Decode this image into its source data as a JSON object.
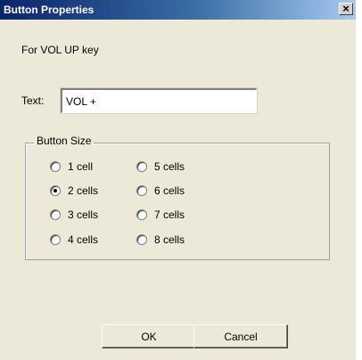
{
  "dialog": {
    "title": "Button Properties",
    "close_glyph": "×",
    "for_label": "For VOL UP key",
    "text_label": "Text:",
    "text_value": "VOL +",
    "group_label": "Button Size",
    "options": [
      {
        "label": "1 cell",
        "checked": false
      },
      {
        "label": "2 cells",
        "checked": true
      },
      {
        "label": "3 cells",
        "checked": false
      },
      {
        "label": "4 cells",
        "checked": false
      },
      {
        "label": "5 cells",
        "checked": false
      },
      {
        "label": "6 cells",
        "checked": false
      },
      {
        "label": "7 cells",
        "checked": false
      },
      {
        "label": "8 cells",
        "checked": false
      }
    ],
    "ok_label": "OK",
    "cancel_label": "Cancel"
  },
  "colors": {
    "title_bar_start": "#0a246a",
    "title_bar_end": "#a6caf0",
    "dialog_bg": "#ece9d8"
  }
}
